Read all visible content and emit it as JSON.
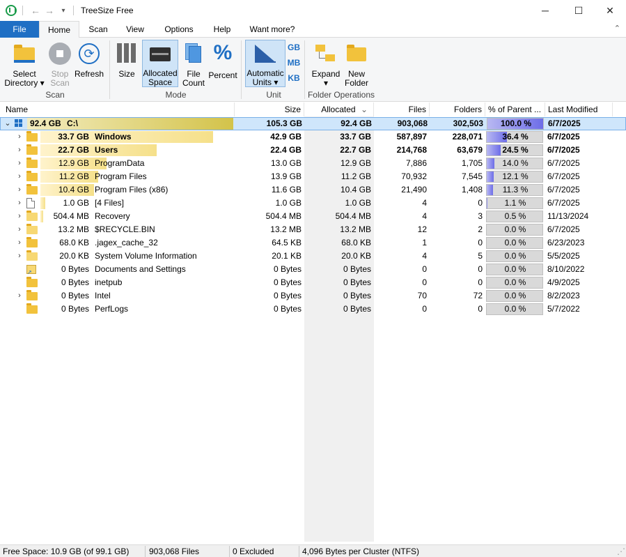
{
  "window": {
    "title": "TreeSize Free",
    "back_icon": "back-arrow-icon",
    "forward_icon": "forward-arrow-icon",
    "min_glyph": "─",
    "max_glyph": "☐",
    "close_glyph": "✕"
  },
  "menu": {
    "tabs": [
      "File",
      "Home",
      "Scan",
      "View",
      "Options",
      "Help",
      "Want more?"
    ],
    "active": "Home",
    "collapse_glyph": "⌃"
  },
  "ribbon": {
    "select_directory": [
      "Select",
      "Directory ▾"
    ],
    "stop_scan": [
      "Stop",
      "Scan"
    ],
    "refresh": [
      "Refresh"
    ],
    "size": [
      "Size"
    ],
    "allocated_space": [
      "Allocated",
      "Space"
    ],
    "file_count": [
      "File",
      "Count"
    ],
    "percent": [
      "Percent"
    ],
    "automatic_units": [
      "Automatic",
      "Units ▾"
    ],
    "unit_gb": "GB",
    "unit_mb": "MB",
    "unit_kb": "KB",
    "expand": [
      "Expand",
      "▾"
    ],
    "new_folder": [
      "New",
      "Folder"
    ],
    "groups": {
      "scan": "Scan",
      "mode": "Mode",
      "unit": "Unit",
      "folder_ops": "Folder Operations"
    }
  },
  "columns": {
    "name": "Name",
    "size": "Size",
    "allocated": "Allocated",
    "allocated_sort": "⌄",
    "files": "Files",
    "folders": "Folders",
    "percent_parent": "% of Parent ...",
    "last_modified": "Last Modified"
  },
  "root": {
    "chevron": "⌄",
    "drive_icon": "windows-drive-icon",
    "alloc_label": "92.4 GB",
    "name": "C:\\",
    "size": "105.3 GB",
    "allocated": "92.4 GB",
    "files": "903,068",
    "folders": "302,503",
    "percent": "100.0 %",
    "percent_value": 100.0,
    "modified": "6/7/2025"
  },
  "rows": [
    {
      "chevron": "›",
      "icon": "folder",
      "alloc_label": "33.7 GB",
      "name": "Windows",
      "size": "42.9 GB",
      "allocated": "33.7 GB",
      "files": "587,897",
      "folders": "228,071",
      "percent": "36.4 %",
      "percent_value": 36.4,
      "modified": "6/7/2025",
      "bold": true
    },
    {
      "chevron": "›",
      "icon": "folder",
      "alloc_label": "22.7 GB",
      "name": "Users",
      "size": "22.4 GB",
      "allocated": "22.7 GB",
      "files": "214,768",
      "folders": "63,679",
      "percent": "24.5 %",
      "percent_value": 24.5,
      "modified": "6/7/2025",
      "bold": true
    },
    {
      "chevron": "›",
      "icon": "folder",
      "alloc_label": "12.9 GB",
      "name": "ProgramData",
      "size": "13.0 GB",
      "allocated": "12.9 GB",
      "files": "7,886",
      "folders": "1,705",
      "percent": "14.0 %",
      "percent_value": 14.0,
      "modified": "6/7/2025",
      "bold": false
    },
    {
      "chevron": "›",
      "icon": "folder",
      "alloc_label": "11.2 GB",
      "name": "Program Files",
      "size": "13.9 GB",
      "allocated": "11.2 GB",
      "files": "70,932",
      "folders": "7,545",
      "percent": "12.1 %",
      "percent_value": 12.1,
      "modified": "6/7/2025",
      "bold": false
    },
    {
      "chevron": "›",
      "icon": "folder",
      "alloc_label": "10.4 GB",
      "name": "Program Files (x86)",
      "size": "11.6 GB",
      "allocated": "10.4 GB",
      "files": "21,490",
      "folders": "1,408",
      "percent": "11.3 %",
      "percent_value": 11.3,
      "modified": "6/7/2025",
      "bold": false
    },
    {
      "chevron": "›",
      "icon": "file",
      "alloc_label": "1.0 GB",
      "name": "[4 Files]",
      "size": "1.0 GB",
      "allocated": "1.0 GB",
      "files": "4",
      "folders": "0",
      "percent": "1.1 %",
      "percent_value": 1.1,
      "modified": "6/7/2025",
      "bold": false
    },
    {
      "chevron": "›",
      "icon": "folder-light",
      "alloc_label": "504.4 MB",
      "name": "Recovery",
      "size": "504.4 MB",
      "allocated": "504.4 MB",
      "files": "4",
      "folders": "3",
      "percent": "0.5 %",
      "percent_value": 0.5,
      "modified": "11/13/2024",
      "bold": false
    },
    {
      "chevron": "›",
      "icon": "folder-light",
      "alloc_label": "13.2 MB",
      "name": "$RECYCLE.BIN",
      "size": "13.2 MB",
      "allocated": "13.2 MB",
      "files": "12",
      "folders": "2",
      "percent": "0.0 %",
      "percent_value": 0.0,
      "modified": "6/7/2025",
      "bold": false
    },
    {
      "chevron": "›",
      "icon": "folder",
      "alloc_label": "68.0 KB",
      "name": ".jagex_cache_32",
      "size": "64.5 KB",
      "allocated": "68.0 KB",
      "files": "1",
      "folders": "0",
      "percent": "0.0 %",
      "percent_value": 0.0,
      "modified": "6/23/2023",
      "bold": false
    },
    {
      "chevron": "›",
      "icon": "folder-light",
      "alloc_label": "20.0 KB",
      "name": "System Volume Information",
      "size": "20.1 KB",
      "allocated": "20.0 KB",
      "files": "4",
      "folders": "5",
      "percent": "0.0 %",
      "percent_value": 0.0,
      "modified": "5/5/2025",
      "bold": false
    },
    {
      "chevron": "",
      "icon": "shortcut",
      "alloc_label": "0 Bytes",
      "name": "Documents and Settings",
      "size": "0 Bytes",
      "allocated": "0 Bytes",
      "files": "0",
      "folders": "0",
      "percent": "0.0 %",
      "percent_value": 0.0,
      "modified": "8/10/2022",
      "bold": false
    },
    {
      "chevron": "",
      "icon": "folder",
      "alloc_label": "0 Bytes",
      "name": "inetpub",
      "size": "0 Bytes",
      "allocated": "0 Bytes",
      "files": "0",
      "folders": "0",
      "percent": "0.0 %",
      "percent_value": 0.0,
      "modified": "4/9/2025",
      "bold": false
    },
    {
      "chevron": "›",
      "icon": "folder",
      "alloc_label": "0 Bytes",
      "name": "Intel",
      "size": "0 Bytes",
      "allocated": "0 Bytes",
      "files": "70",
      "folders": "72",
      "percent": "0.0 %",
      "percent_value": 0.0,
      "modified": "8/2/2023",
      "bold": false
    },
    {
      "chevron": "",
      "icon": "folder",
      "alloc_label": "0 Bytes",
      "name": "PerfLogs",
      "size": "0 Bytes",
      "allocated": "0 Bytes",
      "files": "0",
      "folders": "0",
      "percent": "0.0 %",
      "percent_value": 0.0,
      "modified": "5/7/2022",
      "bold": false
    }
  ],
  "status": {
    "free_space": "Free Space: 10.9 GB  (of 99.1 GB)",
    "files": "903,068 Files",
    "excluded": "0 Excluded",
    "cluster": "4,096 Bytes per Cluster (NTFS)"
  },
  "colors": {
    "accent": "#1f6fc4",
    "root_highlight": "#cfe6fb",
    "percent_fill": "#6d6de8",
    "size_bar": "#f5e08a"
  }
}
